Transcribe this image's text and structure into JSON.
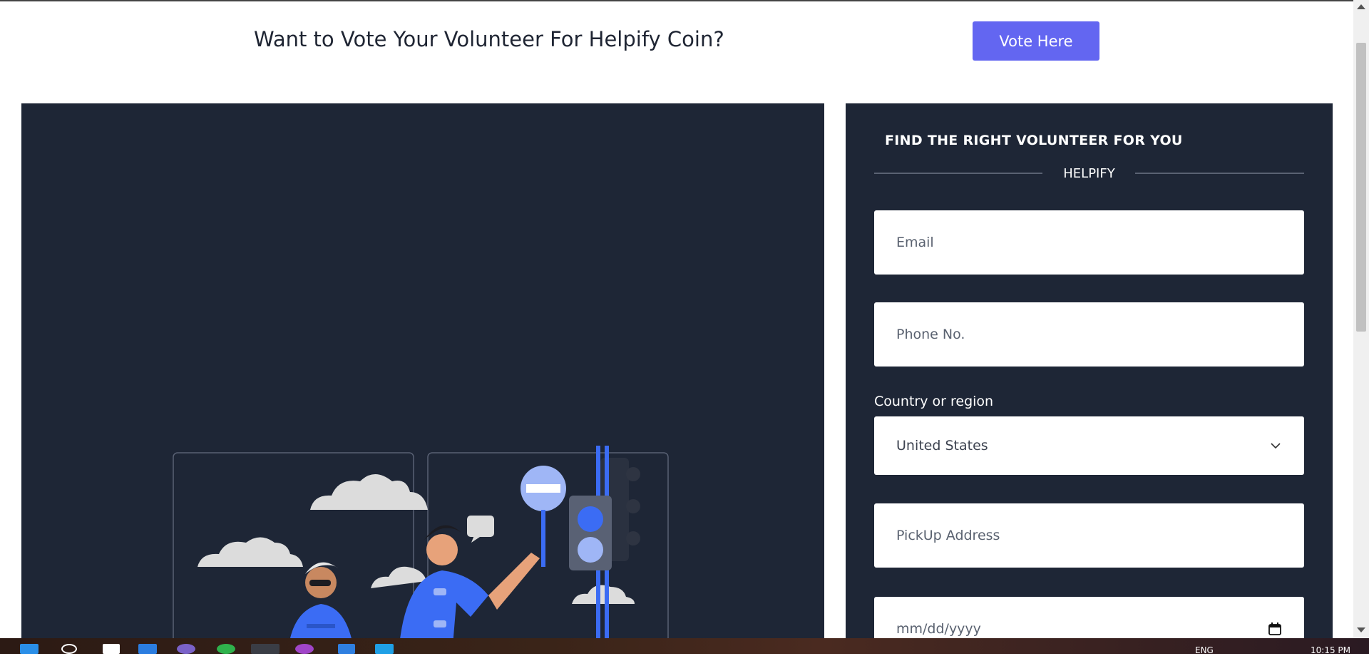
{
  "header": {
    "vote_prompt": "Want to Vote Your Volunteer For Helpify Coin?",
    "vote_button": "Vote Here"
  },
  "form": {
    "heading": "FIND THE RIGHT VOLUNTEER FOR YOU",
    "brand": "HELPIFY",
    "email_placeholder": "Email",
    "phone_placeholder": "Phone No.",
    "country_label": "Country or region",
    "country_value": "United States",
    "pickup_placeholder": "PickUp Address",
    "date_placeholder": "mm/dd/yyyy"
  },
  "taskbar": {
    "language": "ENG",
    "time": "10:15 PM"
  },
  "colors": {
    "accent": "#6366f1",
    "panel_bg": "#1e2636",
    "illustration_blue": "#3b6cf4"
  },
  "icons": [
    "chevron-down-icon",
    "calendar-icon",
    "windows-start-icon",
    "search-icon"
  ]
}
